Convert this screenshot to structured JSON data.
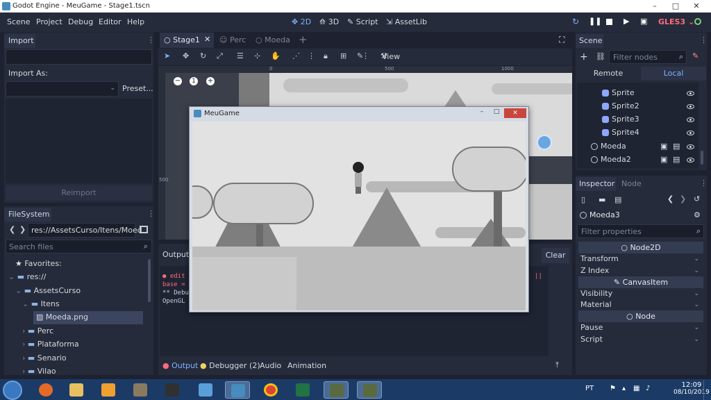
{
  "window": {
    "title": "Godot Engine - MeuGame - Stage1.tscn"
  },
  "menubar": {
    "menus": [
      "Scene",
      "Project",
      "Debug",
      "Editor",
      "Help"
    ],
    "modes": [
      "2D",
      "3D",
      "Script",
      "AssetLib"
    ],
    "renderer": "GLES3"
  },
  "import_panel": {
    "tab": "Import",
    "import_as": "Import As:",
    "preset": "Preset...",
    "reimport": "Reimport"
  },
  "filesystem": {
    "tab": "FileSystem",
    "path": "res://AssetsCurso/Itens/Moed",
    "search_placeholder": "Search files",
    "items": [
      "Favorites:",
      "res://",
      "AssetsCurso",
      "Itens",
      "Moeda.png",
      "Perc",
      "Plataforma",
      "Senario",
      "Vilao"
    ]
  },
  "editor_tabs": [
    "Stage1",
    "Perc",
    "Moeda"
  ],
  "toolbar": {
    "view": "View"
  },
  "ruler": {
    "ticks": [
      "0",
      "500",
      "1000"
    ],
    "v_tick": "500"
  },
  "game_window": {
    "title": "MeuGame"
  },
  "output": {
    "label": "Output",
    "clear": "Clear",
    "lines": [
      "● edit",
      "base =",
      "** Debu",
      "OpenGL"
    ],
    "bottom_tabs": [
      "Output",
      "Debugger (2)",
      "Audio",
      "Animation"
    ]
  },
  "scene_panel": {
    "tab": "Scene",
    "filter_placeholder": "Filter nodes",
    "remote": "Remote",
    "local": "Local",
    "nodes": [
      "Sprite",
      "Sprite2",
      "Sprite3",
      "Sprite4",
      "Moeda",
      "Moeda2"
    ]
  },
  "inspector": {
    "tabs": [
      "Inspector",
      "Node"
    ],
    "object": "Moeda3",
    "filter_placeholder": "Filter properties",
    "sections": {
      "node2d": "Node2D",
      "transform": "Transform",
      "zindex": "Z Index",
      "canvasitem": "CanvasItem",
      "visibility": "Visibility",
      "material": "Material",
      "node": "Node",
      "pause": "Pause",
      "script": "Script"
    }
  },
  "taskbar": {
    "lang": "PT",
    "time": "12:09",
    "date": "08/10/2019"
  },
  "colors": {
    "accent": "#7fb2ff",
    "bg": "#1e2230",
    "panel": "#252b3a",
    "taskbar": "#1b3b66"
  }
}
